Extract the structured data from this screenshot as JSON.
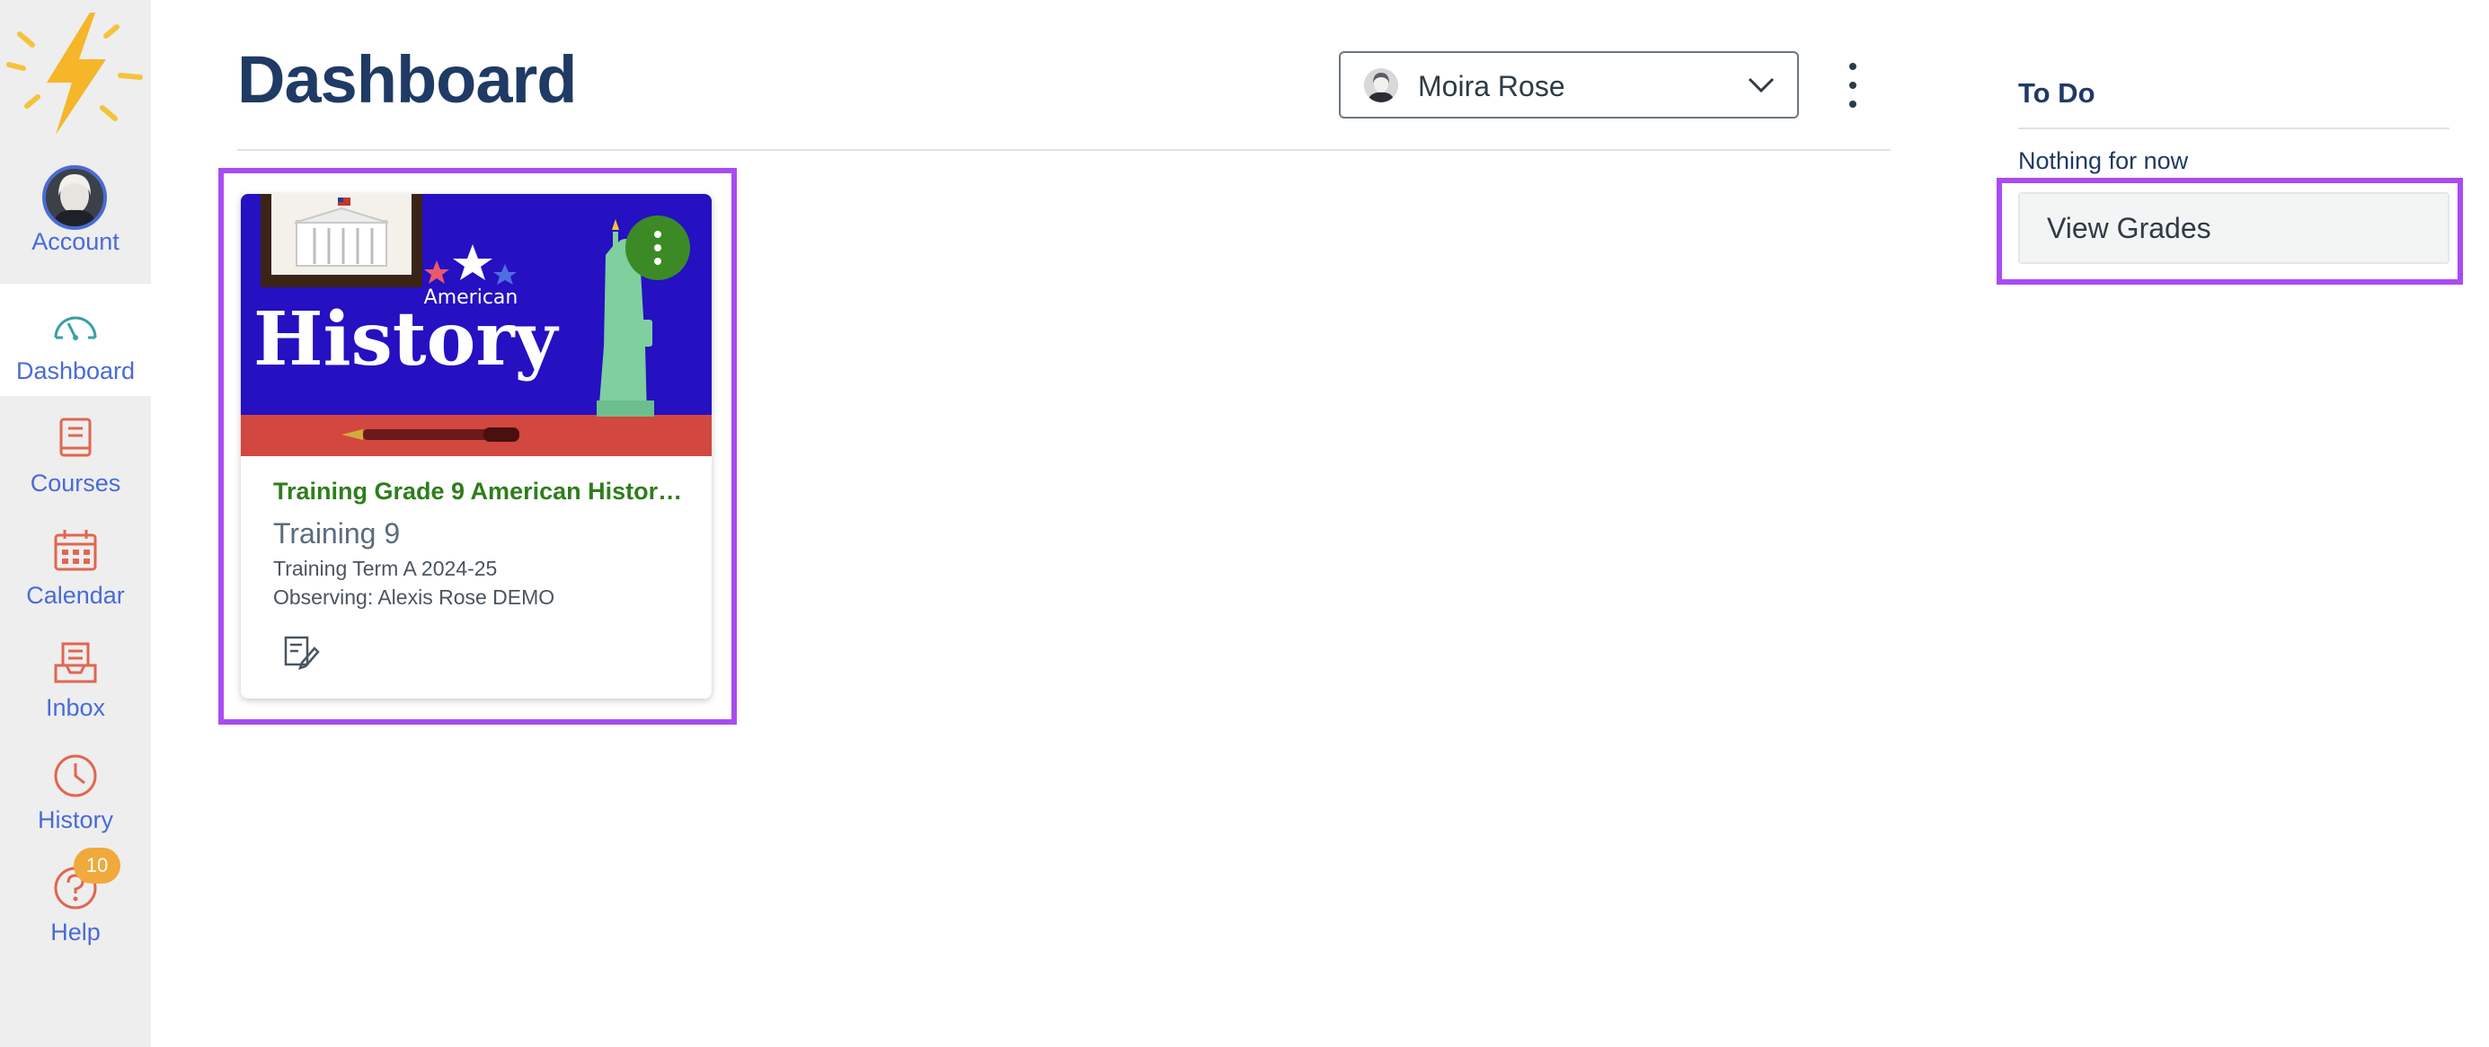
{
  "nav": {
    "items": [
      {
        "key": "account",
        "label": "Account",
        "icon": "avatar"
      },
      {
        "key": "dashboard",
        "label": "Dashboard",
        "icon": "gauge-icon",
        "active": true
      },
      {
        "key": "courses",
        "label": "Courses",
        "icon": "book-icon"
      },
      {
        "key": "calendar",
        "label": "Calendar",
        "icon": "calendar-icon"
      },
      {
        "key": "inbox",
        "label": "Inbox",
        "icon": "inbox-icon"
      },
      {
        "key": "history",
        "label": "History",
        "icon": "clock-icon"
      },
      {
        "key": "help",
        "label": "Help",
        "icon": "help-icon"
      }
    ],
    "help_badge": "10"
  },
  "header": {
    "title": "Dashboard",
    "observer_name": "Moira Rose"
  },
  "card": {
    "hero_word_small": "American",
    "hero_word_large": "History",
    "title": "Training Grade 9 American History…",
    "code": "Training 9",
    "term": "Training Term A 2024-25",
    "observing": "Observing: Alexis Rose DEMO"
  },
  "todo": {
    "title": "To Do",
    "empty": "Nothing for now",
    "view_grades": "View Grades"
  },
  "colors": {
    "nav_bg": "#eeeeee",
    "nav_text": "#4a6bd6",
    "nav_icon": "#e0674f",
    "title": "#1f3a64",
    "card_title": "#2f7d1c",
    "card_options": "#3b8a26",
    "hero_blue": "#2510c2",
    "hero_red": "#d2473f",
    "highlight": "#a94bf2",
    "badge": "#f0a93b"
  }
}
